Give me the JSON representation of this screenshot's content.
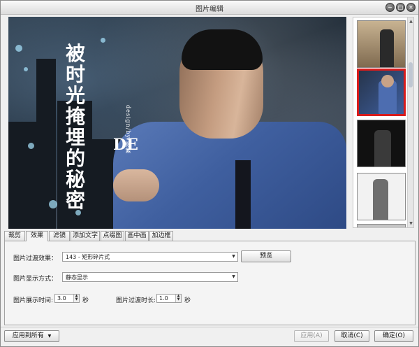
{
  "window": {
    "title": "图片编辑",
    "controls": {
      "minimize_icon": "minimize-icon",
      "maximize_icon": "maximize-icon",
      "close_icon": "close-icon"
    }
  },
  "preview": {
    "poster_text_main": "被时光掩埋的秘密",
    "poster_text_brand": "DE",
    "poster_text_design": "design/by/频繁"
  },
  "thumbnails": {
    "selected_index": 1,
    "count_visible": 5
  },
  "tabs": [
    {
      "label": "裁剪"
    },
    {
      "label": "效果"
    },
    {
      "label": "滤镜"
    },
    {
      "label": "添加文字"
    },
    {
      "label": "点缀图"
    },
    {
      "label": "画中画"
    },
    {
      "label": "加边框"
    }
  ],
  "active_tab": "效果",
  "effects": {
    "transition_label": "图片过渡效果：",
    "transition_value": "143 - 矩形碎片式",
    "preview_button": "预览",
    "display_label": "图片显示方式：",
    "display_value": "静态显示",
    "show_time_label": "图片展示时间:",
    "show_time_value": "3.0",
    "show_time_unit": "秒",
    "transition_time_label": "图片过渡时长:",
    "transition_time_value": "1.0",
    "transition_time_unit": "秒"
  },
  "footer": {
    "apply_all": "应用到所有",
    "apply": "应用(A)",
    "cancel": "取消(C)",
    "ok": "确定(O)"
  },
  "colors": {
    "selected_thumb_border": "#d81c1c",
    "window_background": "#f0f0f0"
  }
}
